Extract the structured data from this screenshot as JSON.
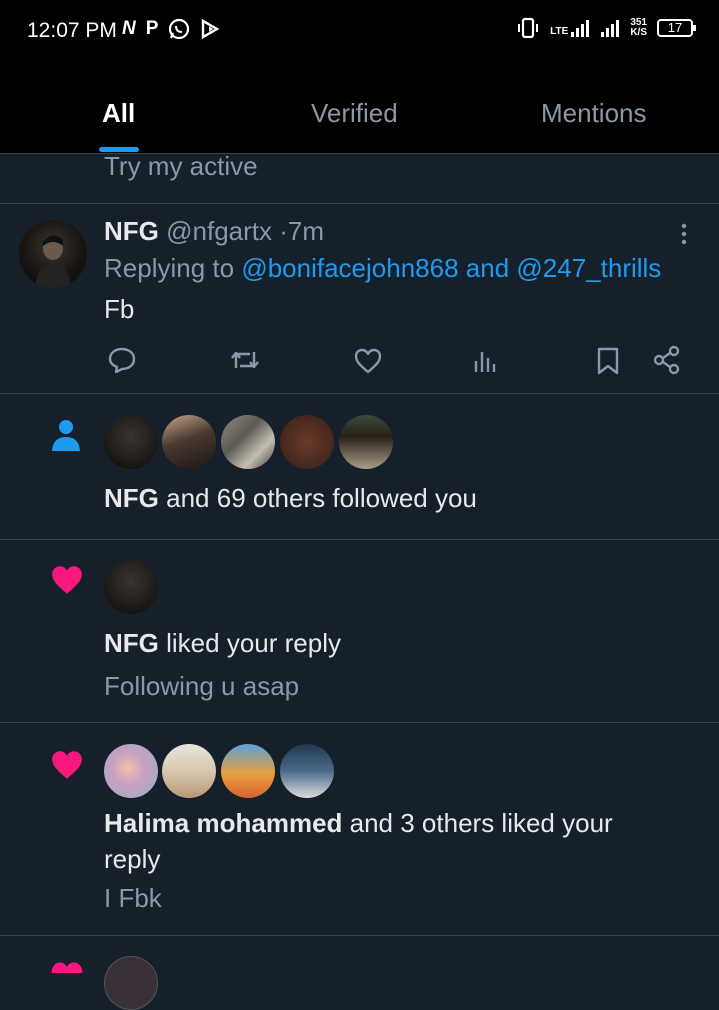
{
  "status_bar": {
    "time": "12:07 PM",
    "left_icons": [
      "N",
      "P",
      "whatsapp-icon",
      "play-icon"
    ],
    "network": "LTE",
    "speed_value": "351",
    "speed_unit": "K/S",
    "battery": "17"
  },
  "tabs": [
    {
      "label": "All",
      "active": true
    },
    {
      "label": "Verified",
      "active": false
    },
    {
      "label": "Mentions",
      "active": false
    }
  ],
  "truncated_item": {
    "text": "Try my active"
  },
  "reply_post": {
    "name": "NFG",
    "handle": "@nfgartx",
    "separator": "·",
    "time": "7m",
    "replying_prefix": "Replying to",
    "replying_user1": "@bonifacejohn868",
    "replying_and": "and",
    "replying_user2": "@247_thrills",
    "text": "Fb",
    "actions": [
      "reply-icon",
      "retweet-icon",
      "like-icon",
      "views-icon",
      "bookmark-icon",
      "share-icon"
    ]
  },
  "follow_notification": {
    "name": "NFG",
    "rest": "and 69 others followed you"
  },
  "like_notification_1": {
    "name": "NFG",
    "rest": "liked your reply",
    "quote": "Following u asap"
  },
  "like_notification_2": {
    "name": "Halima mohammed",
    "rest_line1": "and 3 others liked your",
    "rest_line2": "reply",
    "quote": "I Fbk"
  },
  "colors": {
    "background": "#15202b",
    "accent": "#1d9bf0",
    "like_pink": "#f91880",
    "muted": "#8b98a5"
  }
}
